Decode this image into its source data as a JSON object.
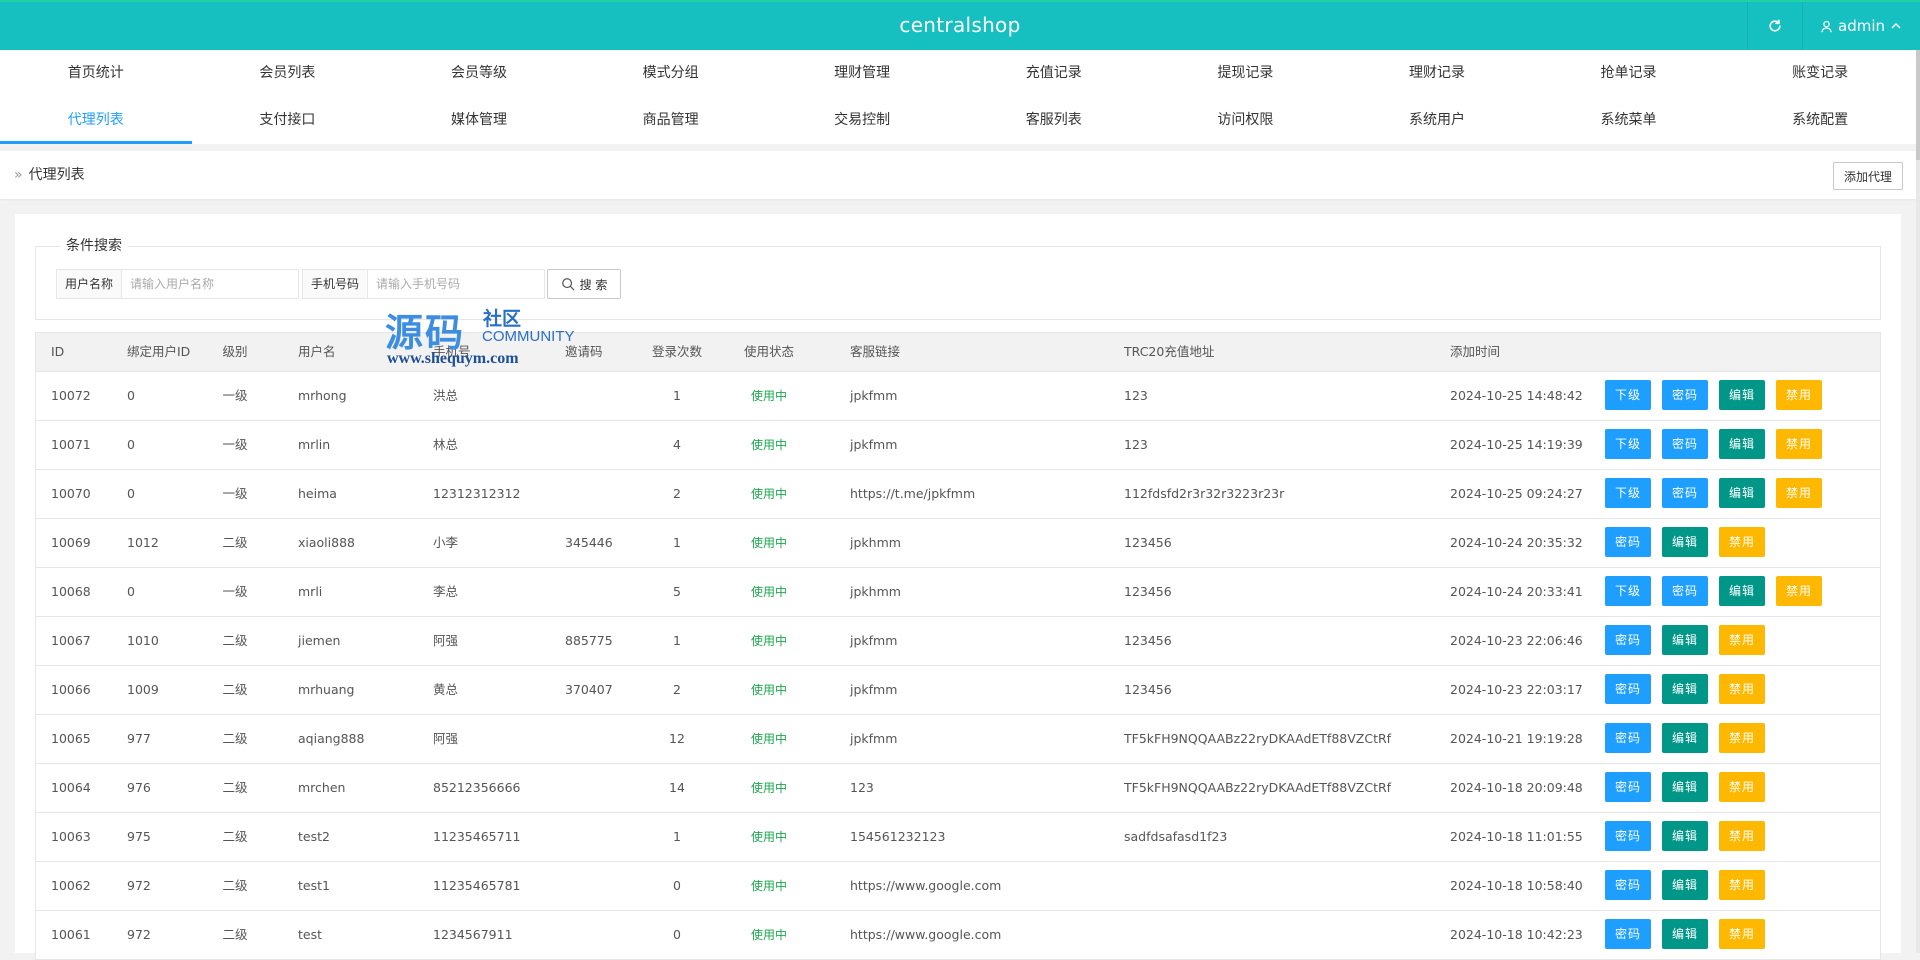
{
  "header": {
    "brand": "centralshop",
    "user": "admin"
  },
  "nav": {
    "row1": [
      "首页统计",
      "会员列表",
      "会员等级",
      "模式分组",
      "理财管理",
      "充值记录",
      "提现记录",
      "理财记录",
      "抢单记录",
      "账变记录"
    ],
    "row2": [
      "代理列表",
      "支付接口",
      "媒体管理",
      "商品管理",
      "交易控制",
      "客服列表",
      "访问权限",
      "系统用户",
      "系统菜单",
      "系统配置"
    ],
    "active": "代理列表"
  },
  "breadcrumb": {
    "title": "代理列表",
    "add_button": "添加代理"
  },
  "search": {
    "legend": "条件搜索",
    "username_label": "用户名称",
    "username_placeholder": "请输入用户名称",
    "phone_label": "手机号码",
    "phone_placeholder": "请输入手机号码",
    "button": "搜 索"
  },
  "watermark": {
    "big": "源码",
    "cn": "社区",
    "en": "COMMUNITY",
    "url": "www.shequym.com"
  },
  "table": {
    "headers": {
      "id": "ID",
      "bind": "绑定用户ID",
      "level": "级别",
      "user": "用户名",
      "phone": "手机号",
      "invite": "邀请码",
      "login": "登录次数",
      "status": "使用状态",
      "cs": "客服链接",
      "trc": "TRC20充值地址",
      "time": "添加时间"
    },
    "rows": [
      {
        "id": "10072",
        "bind": "0",
        "level": "一级",
        "user": "mrhong",
        "phone": "洪总",
        "invite": "",
        "login": "1",
        "status": "使用中",
        "cs": "jpkfmm",
        "trc": "123",
        "time": "2024-10-25 14:48:42",
        "ops": [
          "下级",
          "密码",
          "编辑",
          "禁用"
        ]
      },
      {
        "id": "10071",
        "bind": "0",
        "level": "一级",
        "user": "mrlin",
        "phone": "林总",
        "invite": "",
        "login": "4",
        "status": "使用中",
        "cs": "jpkfmm",
        "trc": "123",
        "time": "2024-10-25 14:19:39",
        "ops": [
          "下级",
          "密码",
          "编辑",
          "禁用"
        ]
      },
      {
        "id": "10070",
        "bind": "0",
        "level": "一级",
        "user": "heima",
        "phone": "12312312312",
        "invite": "",
        "login": "2",
        "status": "使用中",
        "cs": "https://t.me/jpkfmm",
        "trc": "112fdsfd2r3r32r3223r23r",
        "time": "2024-10-25 09:24:27",
        "ops": [
          "下级",
          "密码",
          "编辑",
          "禁用"
        ]
      },
      {
        "id": "10069",
        "bind": "1012",
        "level": "二级",
        "user": "xiaoli888",
        "phone": "小李",
        "invite": "345446",
        "login": "1",
        "status": "使用中",
        "cs": "jpkhmm",
        "trc": "123456",
        "time": "2024-10-24 20:35:32",
        "ops": [
          "密码",
          "编辑",
          "禁用"
        ]
      },
      {
        "id": "10068",
        "bind": "0",
        "level": "一级",
        "user": "mrli",
        "phone": "李总",
        "invite": "",
        "login": "5",
        "status": "使用中",
        "cs": "jpkhmm",
        "trc": "123456",
        "time": "2024-10-24 20:33:41",
        "ops": [
          "下级",
          "密码",
          "编辑",
          "禁用"
        ]
      },
      {
        "id": "10067",
        "bind": "1010",
        "level": "二级",
        "user": "jiemen",
        "phone": "阿强",
        "invite": "885775",
        "login": "1",
        "status": "使用中",
        "cs": "jpkfmm",
        "trc": "123456",
        "time": "2024-10-23 22:06:46",
        "ops": [
          "密码",
          "编辑",
          "禁用"
        ]
      },
      {
        "id": "10066",
        "bind": "1009",
        "level": "二级",
        "user": "mrhuang",
        "phone": "黄总",
        "invite": "370407",
        "login": "2",
        "status": "使用中",
        "cs": "jpkfmm",
        "trc": "123456",
        "time": "2024-10-23 22:03:17",
        "ops": [
          "密码",
          "编辑",
          "禁用"
        ]
      },
      {
        "id": "10065",
        "bind": "977",
        "level": "二级",
        "user": "aqiang888",
        "phone": "阿强",
        "invite": "",
        "login": "12",
        "status": "使用中",
        "cs": "jpkfmm",
        "trc": "TF5kFH9NQQAABz22ryDKAAdETf88VZCtRf",
        "time": "2024-10-21 19:19:28",
        "ops": [
          "密码",
          "编辑",
          "禁用"
        ]
      },
      {
        "id": "10064",
        "bind": "976",
        "level": "二级",
        "user": "mrchen",
        "phone": "85212356666",
        "invite": "",
        "login": "14",
        "status": "使用中",
        "cs": "123",
        "trc": "TF5kFH9NQQAABz22ryDKAAdETf88VZCtRf",
        "time": "2024-10-18 20:09:48",
        "ops": [
          "密码",
          "编辑",
          "禁用"
        ]
      },
      {
        "id": "10063",
        "bind": "975",
        "level": "二级",
        "user": "test2",
        "phone": "11235465711",
        "invite": "",
        "login": "1",
        "status": "使用中",
        "cs": "154561232123",
        "trc": "sadfdsafasd1f23",
        "time": "2024-10-18 11:01:55",
        "ops": [
          "密码",
          "编辑",
          "禁用"
        ]
      },
      {
        "id": "10062",
        "bind": "972",
        "level": "二级",
        "user": "test1",
        "phone": "11235465781",
        "invite": "",
        "login": "0",
        "status": "使用中",
        "cs": "https://www.google.com",
        "trc": "",
        "time": "2024-10-18 10:58:40",
        "ops": [
          "密码",
          "编辑",
          "禁用"
        ]
      },
      {
        "id": "10061",
        "bind": "972",
        "level": "二级",
        "user": "test",
        "phone": "1234567911",
        "invite": "",
        "login": "0",
        "status": "使用中",
        "cs": "https://www.google.com",
        "trc": "",
        "time": "2024-10-18 10:42:23",
        "ops": [
          "密码",
          "编辑",
          "禁用"
        ]
      }
    ]
  },
  "colors": {
    "header": "#16c0c0",
    "active": "#1e9fff",
    "blue": "#1e9fff",
    "teal": "#009688",
    "yellow": "#ffb800",
    "status": "#1aa94c"
  }
}
